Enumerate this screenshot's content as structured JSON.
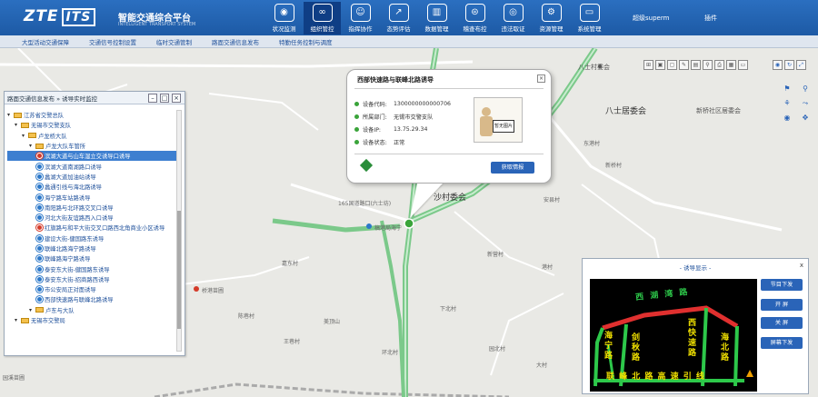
{
  "header": {
    "logo_main": "ZTE",
    "logo_sub": "ITS",
    "system_title": "智能交通综合平台",
    "system_subtitle": "INTELLIGENT TRANSPORT SYSTEM",
    "nav": [
      {
        "label": "状况监测",
        "icon": "eye-icon"
      },
      {
        "label": "组织管控",
        "icon": "chain-icon",
        "active": true
      },
      {
        "label": "指挥协作",
        "icon": "people-icon"
      },
      {
        "label": "态势评估",
        "icon": "chart-icon"
      },
      {
        "label": "数据管理",
        "icon": "bars-icon"
      },
      {
        "label": "稽查布控",
        "icon": "car-icon"
      },
      {
        "label": "违法取证",
        "icon": "camera-icon"
      },
      {
        "label": "资源管理",
        "icon": "gear-icon"
      },
      {
        "label": "系统管理",
        "icon": "monitor-icon"
      }
    ],
    "user": "超级superm",
    "plugin": "插件"
  },
  "subnav": [
    "大型活动交通保障",
    "交通信号控制设置",
    "临时交通管制",
    "路面交通信息发布",
    "特勤任务控制与调度"
  ],
  "tree": {
    "title": "路面交通信息发布 » 诱导实时监控",
    "nodes": [
      {
        "label": "江苏省交警总队",
        "level": 0,
        "type": "folder"
      },
      {
        "label": "无锡市交警支队",
        "level": 1,
        "type": "folder"
      },
      {
        "label": "卢龙桥大队",
        "level": 2,
        "type": "folder"
      },
      {
        "label": "卢龙大队车管所",
        "level": 3,
        "type": "folder"
      },
      {
        "label": "滨湖大道与山车湿立交诱导口诱导",
        "level": 4,
        "type": "cam-red",
        "selected": true
      },
      {
        "label": "滨湖大道南湖路口诱导",
        "level": 4,
        "type": "cam"
      },
      {
        "label": "蠡湖大道加油站诱导",
        "level": 4,
        "type": "cam"
      },
      {
        "label": "蠡通引线与海北路诱导",
        "level": 4,
        "type": "cam"
      },
      {
        "label": "海宁路车站路诱导",
        "level": 4,
        "type": "cam"
      },
      {
        "label": "南阳路与北环路交叉口诱导",
        "level": 4,
        "type": "cam"
      },
      {
        "label": "河北大街友谊路西入口诱导",
        "level": 4,
        "type": "cam"
      },
      {
        "label": "红旗路与和平大街交叉口路西北角商业小区诱导",
        "level": 4,
        "type": "cam-red"
      },
      {
        "label": "建设大街-健国路东诱导",
        "level": 4,
        "type": "cam"
      },
      {
        "label": "联峰北路海宁路诱导",
        "level": 4,
        "type": "cam"
      },
      {
        "label": "联峰路海宁路诱导",
        "level": 4,
        "type": "cam"
      },
      {
        "label": "泰安东大街-健国路东诱导",
        "level": 4,
        "type": "cam"
      },
      {
        "label": "泰安东大街-招商路西诱导",
        "level": 4,
        "type": "cam"
      },
      {
        "label": "市公安局正对面诱导",
        "level": 4,
        "type": "cam"
      },
      {
        "label": "西部快速路与联峰北路诱导",
        "level": 4,
        "type": "cam"
      },
      {
        "label": "卢东与大队",
        "level": 3,
        "type": "folder"
      },
      {
        "label": "无锡市交警局",
        "level": 1,
        "type": "folder"
      }
    ]
  },
  "popup": {
    "title": "西部快速路与联峰北路诱导",
    "rows": [
      {
        "key": "设备代码:",
        "value": "1300000000000706"
      },
      {
        "key": "所属部门:",
        "value": "无锡市交警支队"
      },
      {
        "key": "设备IP:",
        "value": "13.75.29.34"
      },
      {
        "key": "设备状态:",
        "value": "正常"
      }
    ],
    "image_sign": "暂无图片",
    "action": "获取情报"
  },
  "map_labels": [
    {
      "text": "八士村委会",
      "cls": "mid"
    },
    {
      "text": "八士居委会",
      "cls": "big"
    },
    {
      "text": "新桥社区居委会",
      "cls": "mid"
    },
    {
      "text": "165国道路口(六士坊)",
      "cls": ""
    },
    {
      "text": "沙村委会",
      "cls": "big"
    },
    {
      "text": "稿港局海宁",
      "cls": ""
    },
    {
      "text": "桥港苗圃",
      "cls": ""
    },
    {
      "text": "美顶山",
      "cls": ""
    },
    {
      "text": "东港村",
      "cls": ""
    },
    {
      "text": "新桥村",
      "cls": ""
    },
    {
      "text": "安县村",
      "cls": ""
    },
    {
      "text": "新营村",
      "cls": ""
    },
    {
      "text": "港村",
      "cls": ""
    },
    {
      "text": "下北村",
      "cls": ""
    },
    {
      "text": "嘉东村",
      "cls": ""
    },
    {
      "text": "陈巷村",
      "cls": ""
    },
    {
      "text": "王巷村",
      "cls": ""
    },
    {
      "text": "园北村",
      "cls": ""
    },
    {
      "text": "大村",
      "cls": ""
    },
    {
      "text": "环北村",
      "cls": ""
    },
    {
      "text": "园溪苗圃",
      "cls": ""
    }
  ],
  "guide": {
    "title": "- 诱导显示 -",
    "close": "x",
    "roads": {
      "top": "西 湖 湾 路",
      "left": "海宁路",
      "mid": "剑秋路",
      "right": "西快速路",
      "far": "海北路",
      "bottom": "联 峰 北 路 高 速 引 线"
    },
    "buttons": [
      "节目下发",
      "开 屏",
      "关 屏",
      "屏幕下发"
    ]
  },
  "colors": {
    "header": "#1d5aa5",
    "accent": "#2a64b8",
    "road_green": "#2dc84a",
    "road_red": "#e0302f",
    "road_yellow": "#f0e000"
  }
}
